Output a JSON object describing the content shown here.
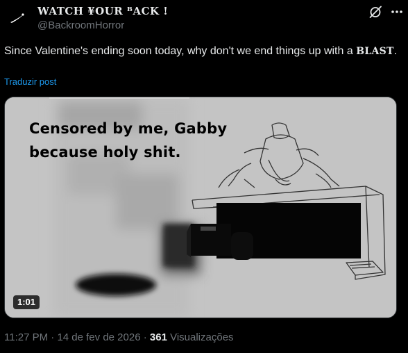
{
  "author": {
    "display_name": "WATCH ¥OUR ᴮACK !",
    "handle": "@BackroomHorror"
  },
  "post": {
    "text_main": "Since Valentine's ending soon today, why don't we end things up with a",
    "text_emphasis": "BLAST",
    "text_end": ".",
    "translate_label": "Traduzir post"
  },
  "media": {
    "overlay_line1": "Censored by me, Gabby",
    "overlay_line2": "because holy shit.",
    "duration": "1:01"
  },
  "meta": {
    "time": "11:27 PM",
    "sep1": " · ",
    "date": "14 de fev de 2026",
    "sep2": " · ",
    "views_count": "361",
    "views_label": " Visualizações"
  },
  "icons": {
    "grok": "grok-icon",
    "more": "more-icon",
    "avatar": "avatar-image"
  },
  "colors": {
    "background": "#000000",
    "text": "#e7e9ea",
    "secondary": "#71767b",
    "link": "#1d9bf0",
    "media_bg": "#c2c2c2"
  }
}
